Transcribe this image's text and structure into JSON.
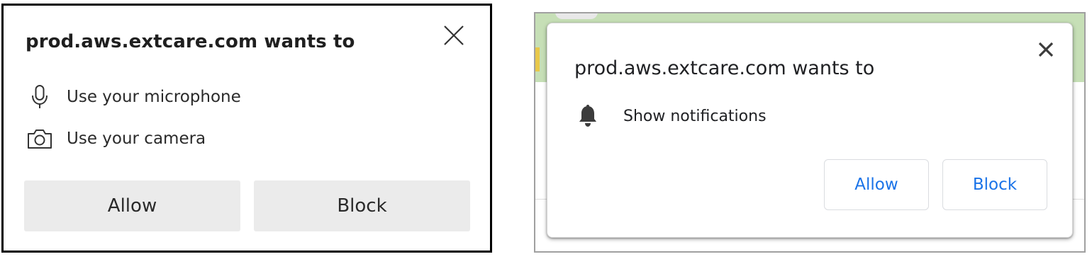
{
  "left_dialog": {
    "title": "prod.aws.extcare.com wants to",
    "close_icon": "close-icon",
    "permissions": [
      {
        "icon": "microphone-icon",
        "label": "Use your microphone"
      },
      {
        "icon": "camera-icon",
        "label": "Use your camera"
      }
    ],
    "allow_label": "Allow",
    "block_label": "Block",
    "colors": {
      "button_bg": "#ebebeb",
      "border": "#000000",
      "text": "#1f1f1f"
    }
  },
  "right_dialog": {
    "title": "prod.aws.extcare.com wants to",
    "close_icon": "close-icon",
    "permissions": [
      {
        "icon": "bell-icon",
        "label": "Show notifications"
      }
    ],
    "allow_label": "Allow",
    "block_label": "Block",
    "colors": {
      "button_text": "#1a73e8",
      "background_band": "#c6dfb6"
    }
  }
}
